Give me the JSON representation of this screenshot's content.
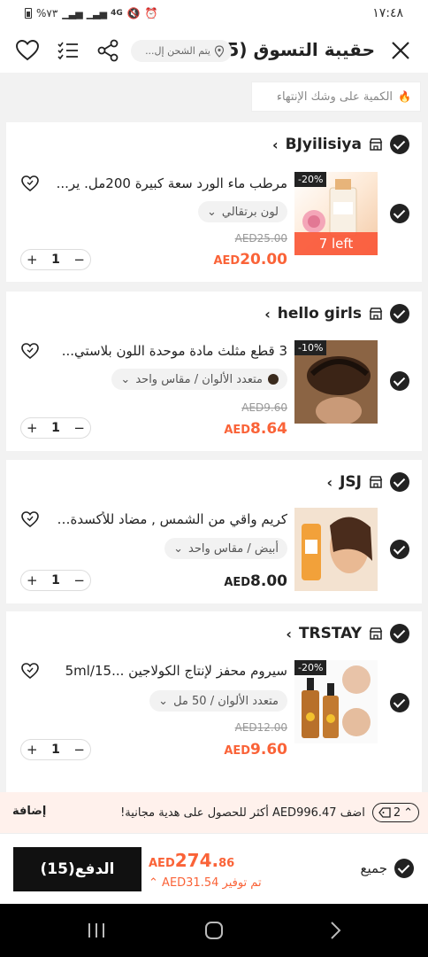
{
  "status": {
    "left_text": "%٧٣",
    "net": "4G",
    "time": "١٧:٤٨"
  },
  "header": {
    "title": "حقيبة التسوق (15)",
    "shipping_text": "يتم الشحن إل..."
  },
  "notice": {
    "text": "الكمية على وشك الإنتهاء"
  },
  "stores": [
    {
      "name": "BJyilisiya",
      "item": {
        "title": "مرطب ماء الورد سعة كبيرة 200مل. ير...",
        "variant": "لون برتقالي",
        "discount": "-20%",
        "badge": "7 left",
        "orig_price": "AED25.00",
        "price_cur": "AED",
        "price": "20.00",
        "qty": "1"
      }
    },
    {
      "name": "hello girls",
      "item": {
        "title": "3 قطع مثلث مادة موحدة اللون بلاستي...",
        "variant": "متعدد الألوان / مقاس واحد",
        "discount": "-10%",
        "orig_price": "AED9.60",
        "price_cur": "AED",
        "price": "8.64",
        "qty": "1"
      }
    },
    {
      "name": "JSJ",
      "item": {
        "title": "كريم واقي من الشمس , مضاد للأكسدة ...",
        "variant": "أبيض / مقاس واحد",
        "price_cur": "AED",
        "price": "8.00",
        "qty": "1"
      }
    },
    {
      "name": "TRSTAY",
      "item": {
        "title": "سيروم محفز لإنتاج الكولاجين ...5ml/15",
        "variant": "متعدد الألوان / 50 مل",
        "discount": "-20%",
        "orig_price": "AED12.00",
        "price_cur": "AED",
        "price": "9.60",
        "qty": "1"
      }
    }
  ],
  "promo": {
    "count": "2",
    "prefix": "اضف",
    "amount": "AED996.47",
    "suffix": "أكثر للحصول على هدية مجانية!",
    "add_label": "إضافة"
  },
  "footer": {
    "all_label": "جميع",
    "total_cur": "AED",
    "total_main": "274.",
    "total_dec": "86",
    "save_text": "تم توفير AED31.54",
    "pay_label": "الدفع(15)"
  },
  "colors": {
    "accent": "#fa6338",
    "primary": "#222222",
    "promo_bg": "#fff1ec"
  }
}
